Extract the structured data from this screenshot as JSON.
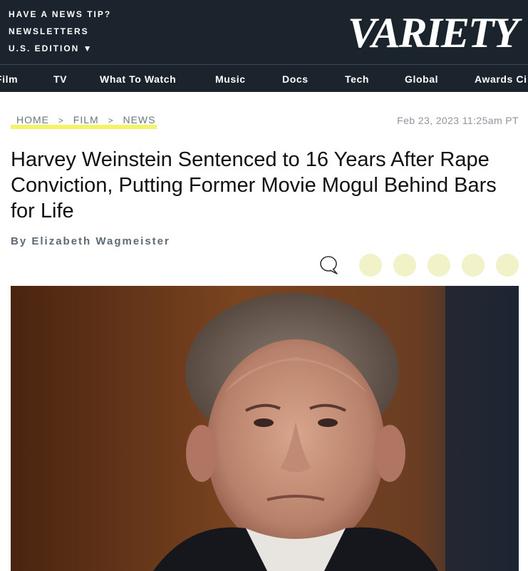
{
  "header": {
    "news_tip": "HAVE A NEWS TIP?",
    "newsletters": "NEWSLETTERS",
    "edition": "U.S. EDITION ▼",
    "logo": "VARIETY"
  },
  "nav": {
    "items": [
      "Film",
      "TV",
      "What To Watch",
      "Music",
      "Docs",
      "Tech",
      "Global",
      "Awards Ci"
    ]
  },
  "breadcrumb": {
    "home": "HOME",
    "sep": ">",
    "film": "FILM",
    "news": "NEWS"
  },
  "article": {
    "date": "Feb 23, 2023 11:25am PT",
    "title": "Harvey Weinstein Sentenced to 16 Years After Rape Conviction, Putting Former Movie Mogul Behind Bars for Life",
    "byline_prefix": "By",
    "author": "Elizabeth Wagmeister"
  },
  "icons": {
    "comment": "comment-icon",
    "share_buttons": [
      "share-button-1",
      "share-button-2",
      "share-button-3",
      "share-button-4",
      "share-button-5"
    ]
  },
  "colors": {
    "header_bg": "#1b242c",
    "breadcrumb_highlight": "#f3f36a",
    "share_dot": "#f1f2c7"
  }
}
